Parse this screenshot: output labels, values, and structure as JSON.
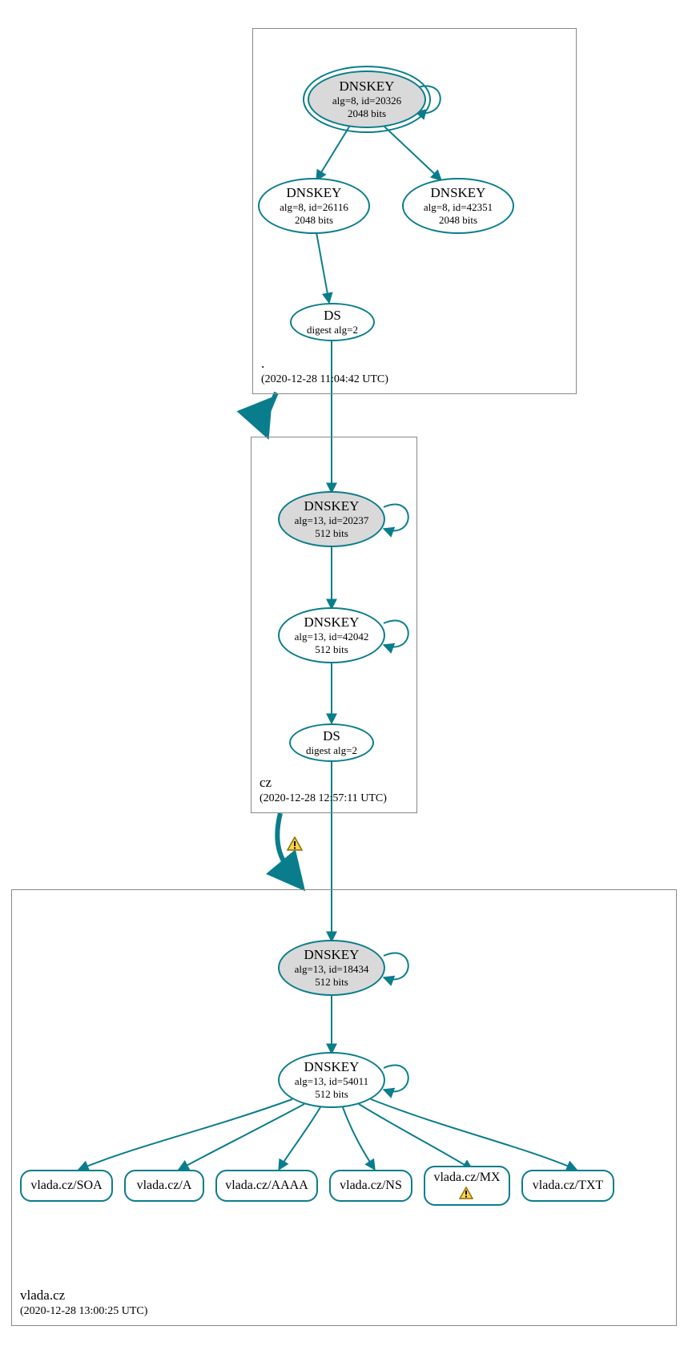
{
  "colors": {
    "teal": "#0a7d8c",
    "node_fill_grey": "#d9d9d9",
    "warn_fill": "#ffd24d",
    "warn_stroke": "#8a6d00"
  },
  "zones": {
    "root": {
      "name": ".",
      "timestamp": "(2020-12-28 11:04:42 UTC)",
      "keys": {
        "ksk": {
          "title": "DNSKEY",
          "line1": "alg=8, id=20326",
          "line2": "2048 bits"
        },
        "zsk_l": {
          "title": "DNSKEY",
          "line1": "alg=8, id=26116",
          "line2": "2048 bits"
        },
        "zsk_r": {
          "title": "DNSKEY",
          "line1": "alg=8, id=42351",
          "line2": "2048 bits"
        }
      },
      "ds": {
        "title": "DS",
        "line1": "digest alg=2"
      }
    },
    "cz": {
      "name": "cz",
      "timestamp": "(2020-12-28 12:57:11 UTC)",
      "keys": {
        "ksk": {
          "title": "DNSKEY",
          "line1": "alg=13, id=20237",
          "line2": "512 bits"
        },
        "zsk": {
          "title": "DNSKEY",
          "line1": "alg=13, id=42042",
          "line2": "512 bits"
        }
      },
      "ds": {
        "title": "DS",
        "line1": "digest alg=2"
      }
    },
    "vlada": {
      "name": "vlada.cz",
      "timestamp": "(2020-12-28 13:00:25 UTC)",
      "keys": {
        "ksk": {
          "title": "DNSKEY",
          "line1": "alg=13, id=18434",
          "line2": "512 bits"
        },
        "zsk": {
          "title": "DNSKEY",
          "line1": "alg=13, id=54011",
          "line2": "512 bits"
        }
      },
      "rrsets": {
        "soa": "vlada.cz/SOA",
        "a": "vlada.cz/A",
        "aaaa": "vlada.cz/AAAA",
        "ns": "vlada.cz/NS",
        "mx": "vlada.cz/MX",
        "txt": "vlada.cz/TXT"
      }
    }
  },
  "warnings": {
    "cz_to_vlada_delegation": true,
    "vlada_mx": true
  }
}
